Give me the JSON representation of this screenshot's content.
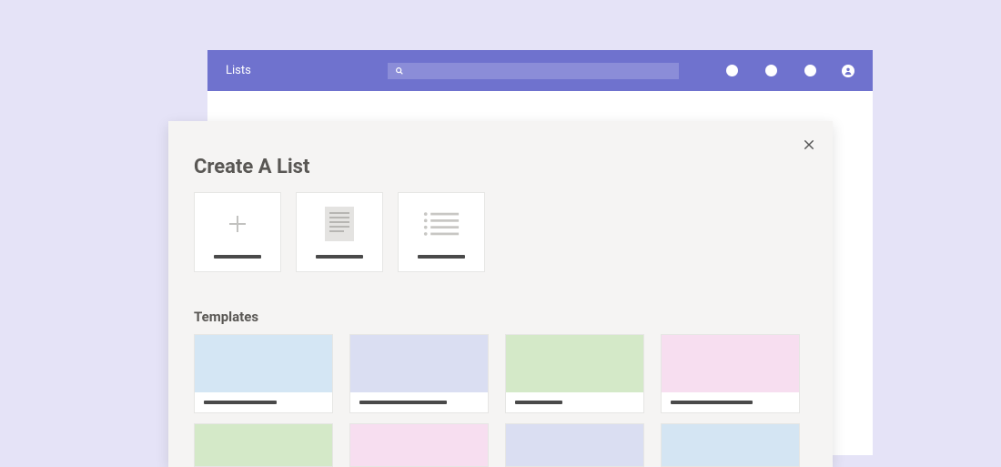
{
  "header": {
    "title": "Lists",
    "search_placeholder": ""
  },
  "modal": {
    "title": "Create A List",
    "templates_heading": "Templates",
    "options": [
      {
        "name": "blank-list",
        "icon": "plus"
      },
      {
        "name": "page-list",
        "icon": "page"
      },
      {
        "name": "bulleted-list",
        "icon": "bullets"
      }
    ],
    "templates": [
      {
        "color": "#d4e6f4",
        "label_width": 80
      },
      {
        "color": "#dadef2",
        "label_width": 96
      },
      {
        "color": "#d4e9c8",
        "label_width": 52
      },
      {
        "color": "#f7def0",
        "label_width": 90
      }
    ],
    "templates_row2": [
      {
        "color": "#d4e9c8"
      },
      {
        "color": "#f7def0"
      },
      {
        "color": "#dadef2"
      },
      {
        "color": "#d4e5f3"
      }
    ]
  }
}
